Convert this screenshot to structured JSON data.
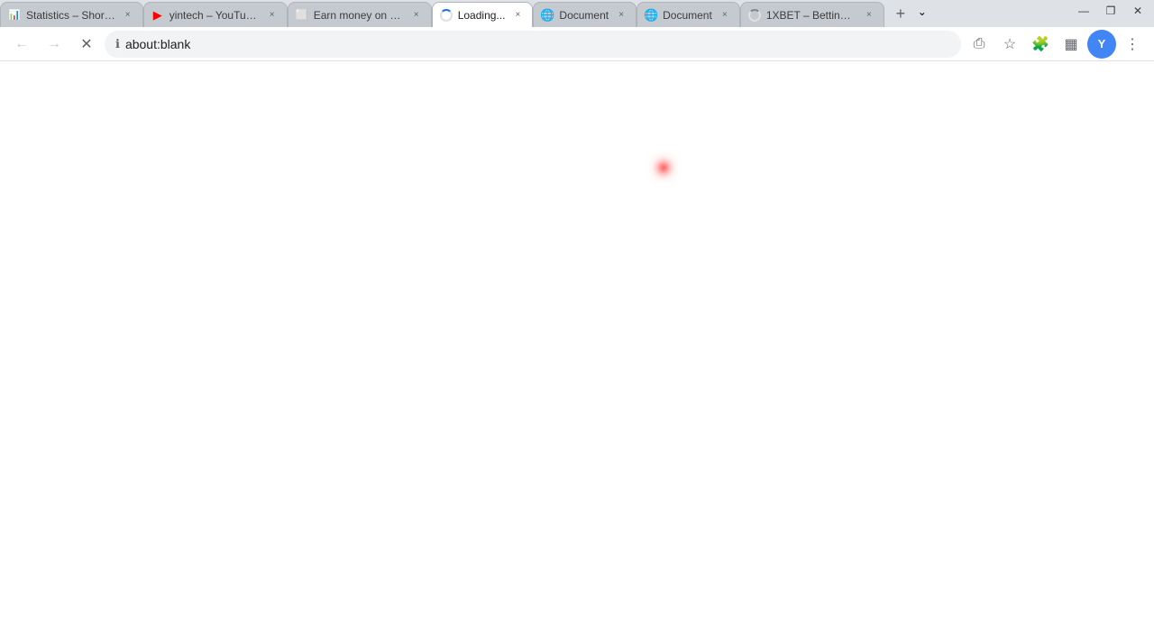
{
  "titlebar": {
    "tabs": [
      {
        "id": "tab-1",
        "title": "Statistics – Shor…",
        "favicon_type": "red-square",
        "active": false,
        "close_label": "×"
      },
      {
        "id": "tab-2",
        "title": "yintech – YouTub…",
        "favicon_type": "youtube",
        "active": false,
        "close_label": "×"
      },
      {
        "id": "tab-3",
        "title": "Earn money on s…",
        "favicon_type": "gray-square",
        "active": false,
        "close_label": "×"
      },
      {
        "id": "tab-4",
        "title": "Loading...",
        "favicon_type": "loading",
        "active": true,
        "close_label": "×"
      },
      {
        "id": "tab-5",
        "title": "Document",
        "favicon_type": "document-blue",
        "active": false,
        "close_label": "×"
      },
      {
        "id": "tab-6",
        "title": "Document",
        "favicon_type": "document-blue",
        "active": false,
        "close_label": "×"
      },
      {
        "id": "tab-7",
        "title": "1XBET – Betting…",
        "favicon_type": "betting-spinner",
        "active": false,
        "close_label": "×"
      }
    ],
    "new_tab_label": "+",
    "tab_overflow_label": "⌄",
    "window_controls": {
      "minimize": "—",
      "maximize": "❐",
      "close": "✕"
    }
  },
  "navbar": {
    "back_label": "←",
    "forward_label": "→",
    "reload_label": "✕",
    "address": "about:blank",
    "share_label": "⎙",
    "bookmark_label": "☆",
    "extensions_label": "🧩",
    "sidebar_label": "▦",
    "profile_label": "Y",
    "menu_label": "⋮"
  },
  "page": {
    "background": "#ffffff",
    "cursor_visible": true
  }
}
